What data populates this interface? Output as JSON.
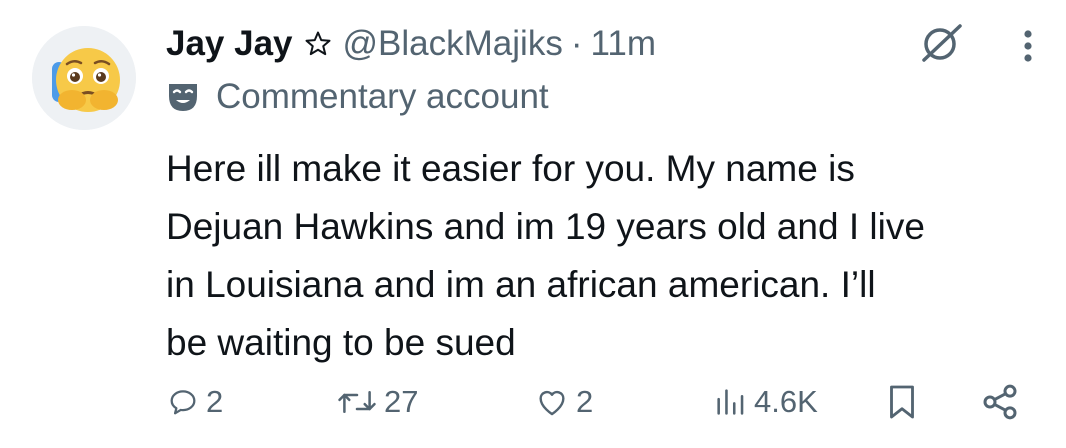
{
  "post": {
    "author": {
      "display_name": "Jay Jay",
      "handle": "@BlackMajiks",
      "time": "11m",
      "account_label": "Commentary account"
    },
    "text": "Here ill make it easier for you. My name is\nDejuan Hawkins and im 19 years old and I live\nin Louisiana and im an african american. I’ll\nbe waiting to be sued",
    "stats": {
      "replies": "2",
      "reposts": "27",
      "likes": "2",
      "views": "4.6K"
    }
  },
  "icons": {
    "avatar": "crying-face-emoji-avatar",
    "star": "star-outline-icon",
    "grok": "grok-icon",
    "more": "more-vertical-icon",
    "label": "theater-mask-icon",
    "reply": "reply-icon",
    "repost": "repost-icon",
    "like": "heart-icon",
    "views": "views-chart-icon",
    "bookmark": "bookmark-icon",
    "share": "share-icon"
  },
  "colors": {
    "text": "#0f1419",
    "secondary": "#536471",
    "background": "#ffffff"
  }
}
